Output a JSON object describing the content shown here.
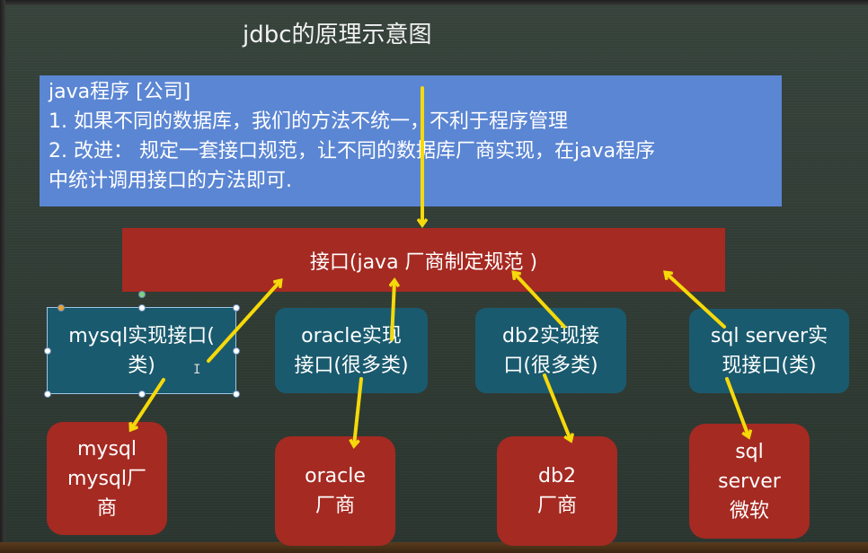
{
  "title": "jdbc的原理示意图",
  "note": {
    "lines": [
      "java程序 [公司]",
      "1. 如果不同的数据库，我们的方法不统一，不利于程序管理",
      "2. 改进： 规定一套接口规范，让不同的数据库厂商实现，在java程序",
      "中统计调用接口的方法即可."
    ]
  },
  "interface": {
    "label": "接口(java 厂商制定规范 )"
  },
  "implementations": [
    {
      "line1": "mysql实现接口(",
      "line2": "类)"
    },
    {
      "line1": "oracle实现",
      "line2": "接口(很多类)"
    },
    {
      "line1": "db2实现接",
      "line2": "口(很多类)"
    },
    {
      "line1": "sql server实",
      "line2": "现接口(类)"
    }
  ],
  "vendors": [
    {
      "lines": [
        "mysql",
        "mysql厂",
        "商"
      ]
    },
    {
      "lines": [
        "oracle",
        "厂商"
      ]
    },
    {
      "lines": [
        "db2",
        "厂商"
      ]
    },
    {
      "lines": [
        "sql",
        "server",
        "微软"
      ]
    }
  ],
  "colors": {
    "background": "#2f3b34",
    "note": "#5b86d3",
    "interface": "#a52a22",
    "implementation": "#1a5a6e",
    "vendor": "#a52a22",
    "arrow": "#f5d90a"
  }
}
